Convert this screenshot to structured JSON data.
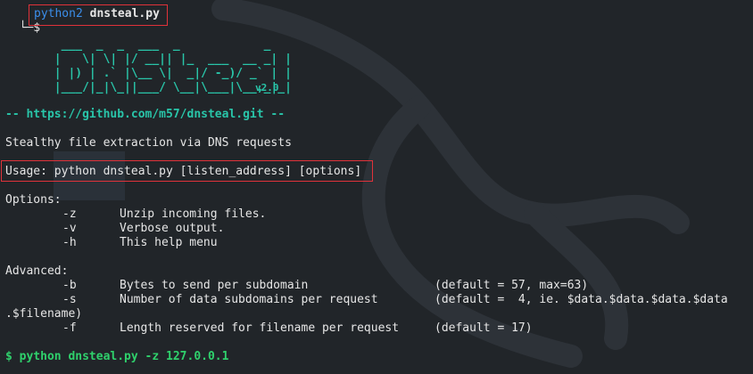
{
  "prompt": {
    "corner": "└─$",
    "command": "python2",
    "argument": "dnsteal.py"
  },
  "banner": {
    "art_lines": [
      "        ___  _  _  ___  _            _  ",
      "       |   \\| \\| |/ __|| |_  ___  __ _| | ",
      "       | |) | .` |\\__ \\|  _|/ -_)/ _` | | ",
      "       |___/|_|\\_||___/ \\__|\\___|\\__,_|_|"
    ],
    "version": "v2.0",
    "url_line": "-- https://github.com/m57/dnsteal.git --"
  },
  "description": "Stealthy file extraction via DNS requests",
  "usage": "Usage: python dnsteal.py [listen_address] [options]",
  "options": {
    "heading": "Options:",
    "items": [
      {
        "flag": "-z",
        "text": "Unzip incoming files."
      },
      {
        "flag": "-v",
        "text": "Verbose output."
      },
      {
        "flag": "-h",
        "text": "This help menu"
      }
    ]
  },
  "advanced": {
    "heading": "Advanced:",
    "items": [
      {
        "flag": "-b",
        "text": "Bytes to send per subdomain",
        "default": "(default = 57, max=63)"
      },
      {
        "flag": "-s",
        "text": "Number of data subdomains per request",
        "default": "(default =  4, ie. $data.$data.$data.$data"
      },
      {
        "flag": "-f",
        "text": "Length reserved for filename per request",
        "default": "(default = 17)"
      }
    ],
    "wrap_continuation": ".$filename)"
  },
  "example": "$ python dnsteal.py -z 127.0.0.1",
  "colors": {
    "background": "#212529",
    "prompt_blue": "#3b8eea",
    "accent_cyan": "#29c5a9",
    "example_green": "#2fd16c",
    "highlight_red": "#e0323a"
  }
}
